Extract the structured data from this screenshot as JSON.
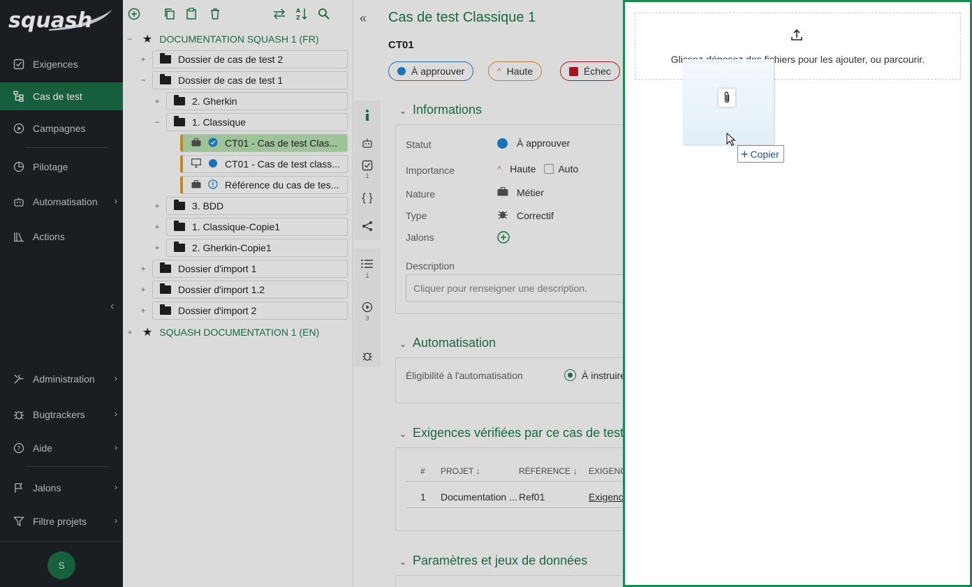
{
  "brand": {
    "logo_text": "squash"
  },
  "nav": {
    "items": [
      {
        "label": "Exigences",
        "icon": "checkbox-icon",
        "active": false
      },
      {
        "label": "Cas de test",
        "icon": "tree-icon",
        "active": true
      },
      {
        "label": "Campagnes",
        "icon": "play-circle-icon",
        "active": false
      },
      {
        "label": "Pilotage",
        "icon": "pie-chart-icon",
        "active": false
      },
      {
        "label": "Automatisation",
        "icon": "robot-icon",
        "active": false
      },
      {
        "label": "Actions",
        "icon": "library-icon",
        "active": false
      },
      {
        "label": "Administration",
        "icon": "tools-icon",
        "active": false
      },
      {
        "label": "Bugtrackers",
        "icon": "bug-icon",
        "active": false
      },
      {
        "label": "Aide",
        "icon": "help-icon",
        "active": false
      },
      {
        "label": "Jalons",
        "icon": "flag-icon",
        "active": false
      },
      {
        "label": "Filtre projets",
        "icon": "filter-icon",
        "active": false
      }
    ],
    "avatar_initial": "S",
    "active_color": "#1b6b45"
  },
  "tree": {
    "nodes": [
      {
        "label": "DOCUMENTATION SQUASH 1 (FR)",
        "type": "project",
        "expand": "−"
      },
      {
        "label": "Dossier de cas de test 2",
        "type": "folder",
        "expand": "+"
      },
      {
        "label": "Dossier de cas de test 1",
        "type": "folder",
        "expand": "−"
      },
      {
        "label": "2. Gherkin",
        "type": "folder",
        "expand": "+"
      },
      {
        "label": "1. Classique",
        "type": "folder",
        "expand": "−"
      },
      {
        "label": "CT01 - Cas de test Clas...",
        "type": "testcase",
        "selected": true
      },
      {
        "label": "CT01 - Cas de test class...",
        "type": "testcase"
      },
      {
        "label": "Référence du cas de tes...",
        "type": "testcase"
      },
      {
        "label": "3. BDD",
        "type": "folder",
        "expand": "+"
      },
      {
        "label": "1. Classique-Copie1",
        "type": "folder",
        "expand": "+"
      },
      {
        "label": "2. Gherkin-Copie1",
        "type": "folder",
        "expand": "+"
      },
      {
        "label": "Dossier d'import 1",
        "type": "folder",
        "expand": "+"
      },
      {
        "label": "Dossier d'import 1.2",
        "type": "folder",
        "expand": "+"
      },
      {
        "label": "Dossier d'import 2",
        "type": "folder",
        "expand": "+"
      },
      {
        "label": "SQUASH DOCUMENTATION 1 (EN)",
        "type": "project",
        "expand": "+"
      }
    ]
  },
  "side_counts": {
    "checks": "1",
    "steps": "1",
    "executions": "3"
  },
  "testcase": {
    "title": "Cas de test Classique 1",
    "reference": "CT01",
    "status_pill": "À approuver",
    "importance_pill": "Haute",
    "result_pill": "Échec",
    "sections": {
      "informations": "Informations",
      "automatisation": "Automatisation",
      "exigences": "Exigences vérifiées par ce cas de test",
      "parametres": "Paramètres et jeux de données"
    },
    "fields": {
      "statut_label": "Statut",
      "statut_value": "À approuver",
      "importance_label": "Importance",
      "importance_value": "Haute",
      "auto_label": "Auto",
      "nature_label": "Nature",
      "nature_value": "Métier",
      "type_label": "Type",
      "type_value": "Correctif",
      "jalons_label": "Jalons",
      "description_label": "Description",
      "description_placeholder": "Cliquer pour renseigner une description."
    },
    "automation": {
      "eligibility_label": "Éligibilité à l'automatisation",
      "eligibility_value": "À instruire"
    },
    "requirements_table": {
      "headers": [
        "#",
        "PROJET",
        "RÉFÉRENCE",
        "EXIGENC"
      ],
      "rows": [
        [
          "1",
          "Documentation ...",
          "Ref01",
          "Exigenc"
        ]
      ]
    }
  },
  "drawer": {
    "dropzone_text": "Glissez-déposez des fichiers pour les ajouter, ou parcourir.",
    "copy_tooltip": "Copier"
  }
}
